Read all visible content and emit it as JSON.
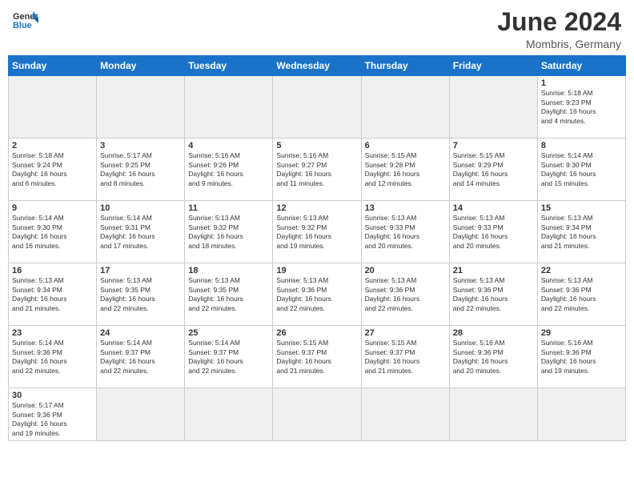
{
  "header": {
    "logo_general": "General",
    "logo_blue": "Blue",
    "month_year": "June 2024",
    "location": "Mombris, Germany"
  },
  "weekdays": [
    "Sunday",
    "Monday",
    "Tuesday",
    "Wednesday",
    "Thursday",
    "Friday",
    "Saturday"
  ],
  "weeks": [
    [
      {
        "day": "",
        "info": "",
        "empty": true
      },
      {
        "day": "",
        "info": "",
        "empty": true
      },
      {
        "day": "",
        "info": "",
        "empty": true
      },
      {
        "day": "",
        "info": "",
        "empty": true
      },
      {
        "day": "",
        "info": "",
        "empty": true
      },
      {
        "day": "",
        "info": "",
        "empty": true
      },
      {
        "day": "1",
        "info": "Sunrise: 5:18 AM\nSunset: 9:23 PM\nDaylight: 16 hours\nand 4 minutes."
      }
    ],
    [
      {
        "day": "2",
        "info": "Sunrise: 5:18 AM\nSunset: 9:24 PM\nDaylight: 16 hours\nand 6 minutes."
      },
      {
        "day": "3",
        "info": "Sunrise: 5:17 AM\nSunset: 9:25 PM\nDaylight: 16 hours\nand 8 minutes."
      },
      {
        "day": "4",
        "info": "Sunrise: 5:16 AM\nSunset: 9:26 PM\nDaylight: 16 hours\nand 9 minutes."
      },
      {
        "day": "5",
        "info": "Sunrise: 5:16 AM\nSunset: 9:27 PM\nDaylight: 16 hours\nand 11 minutes."
      },
      {
        "day": "6",
        "info": "Sunrise: 5:15 AM\nSunset: 9:28 PM\nDaylight: 16 hours\nand 12 minutes."
      },
      {
        "day": "7",
        "info": "Sunrise: 5:15 AM\nSunset: 9:29 PM\nDaylight: 16 hours\nand 14 minutes."
      },
      {
        "day": "8",
        "info": "Sunrise: 5:14 AM\nSunset: 9:30 PM\nDaylight: 16 hours\nand 15 minutes."
      }
    ],
    [
      {
        "day": "9",
        "info": "Sunrise: 5:14 AM\nSunset: 9:30 PM\nDaylight: 16 hours\nand 16 minutes."
      },
      {
        "day": "10",
        "info": "Sunrise: 5:14 AM\nSunset: 9:31 PM\nDaylight: 16 hours\nand 17 minutes."
      },
      {
        "day": "11",
        "info": "Sunrise: 5:13 AM\nSunset: 9:32 PM\nDaylight: 16 hours\nand 18 minutes."
      },
      {
        "day": "12",
        "info": "Sunrise: 5:13 AM\nSunset: 9:32 PM\nDaylight: 16 hours\nand 19 minutes."
      },
      {
        "day": "13",
        "info": "Sunrise: 5:13 AM\nSunset: 9:33 PM\nDaylight: 16 hours\nand 20 minutes."
      },
      {
        "day": "14",
        "info": "Sunrise: 5:13 AM\nSunset: 9:33 PM\nDaylight: 16 hours\nand 20 minutes."
      },
      {
        "day": "15",
        "info": "Sunrise: 5:13 AM\nSunset: 9:34 PM\nDaylight: 16 hours\nand 21 minutes."
      }
    ],
    [
      {
        "day": "16",
        "info": "Sunrise: 5:13 AM\nSunset: 9:34 PM\nDaylight: 16 hours\nand 21 minutes."
      },
      {
        "day": "17",
        "info": "Sunrise: 5:13 AM\nSunset: 9:35 PM\nDaylight: 16 hours\nand 22 minutes."
      },
      {
        "day": "18",
        "info": "Sunrise: 5:13 AM\nSunset: 9:35 PM\nDaylight: 16 hours\nand 22 minutes."
      },
      {
        "day": "19",
        "info": "Sunrise: 5:13 AM\nSunset: 9:36 PM\nDaylight: 16 hours\nand 22 minutes."
      },
      {
        "day": "20",
        "info": "Sunrise: 5:13 AM\nSunset: 9:36 PM\nDaylight: 16 hours\nand 22 minutes."
      },
      {
        "day": "21",
        "info": "Sunrise: 5:13 AM\nSunset: 9:36 PM\nDaylight: 16 hours\nand 22 minutes."
      },
      {
        "day": "22",
        "info": "Sunrise: 5:13 AM\nSunset: 9:36 PM\nDaylight: 16 hours\nand 22 minutes."
      }
    ],
    [
      {
        "day": "23",
        "info": "Sunrise: 5:14 AM\nSunset: 9:36 PM\nDaylight: 16 hours\nand 22 minutes."
      },
      {
        "day": "24",
        "info": "Sunrise: 5:14 AM\nSunset: 9:37 PM\nDaylight: 16 hours\nand 22 minutes."
      },
      {
        "day": "25",
        "info": "Sunrise: 5:14 AM\nSunset: 9:37 PM\nDaylight: 16 hours\nand 22 minutes."
      },
      {
        "day": "26",
        "info": "Sunrise: 5:15 AM\nSunset: 9:37 PM\nDaylight: 16 hours\nand 21 minutes."
      },
      {
        "day": "27",
        "info": "Sunrise: 5:15 AM\nSunset: 9:37 PM\nDaylight: 16 hours\nand 21 minutes."
      },
      {
        "day": "28",
        "info": "Sunrise: 5:16 AM\nSunset: 9:36 PM\nDaylight: 16 hours\nand 20 minutes."
      },
      {
        "day": "29",
        "info": "Sunrise: 5:16 AM\nSunset: 9:36 PM\nDaylight: 16 hours\nand 19 minutes."
      }
    ],
    [
      {
        "day": "30",
        "info": "Sunrise: 5:17 AM\nSunset: 9:36 PM\nDaylight: 16 hours\nand 19 minutes."
      },
      {
        "day": "",
        "info": "",
        "empty": true
      },
      {
        "day": "",
        "info": "",
        "empty": true
      },
      {
        "day": "",
        "info": "",
        "empty": true
      },
      {
        "day": "",
        "info": "",
        "empty": true
      },
      {
        "day": "",
        "info": "",
        "empty": true
      },
      {
        "day": "",
        "info": "",
        "empty": true
      }
    ]
  ]
}
